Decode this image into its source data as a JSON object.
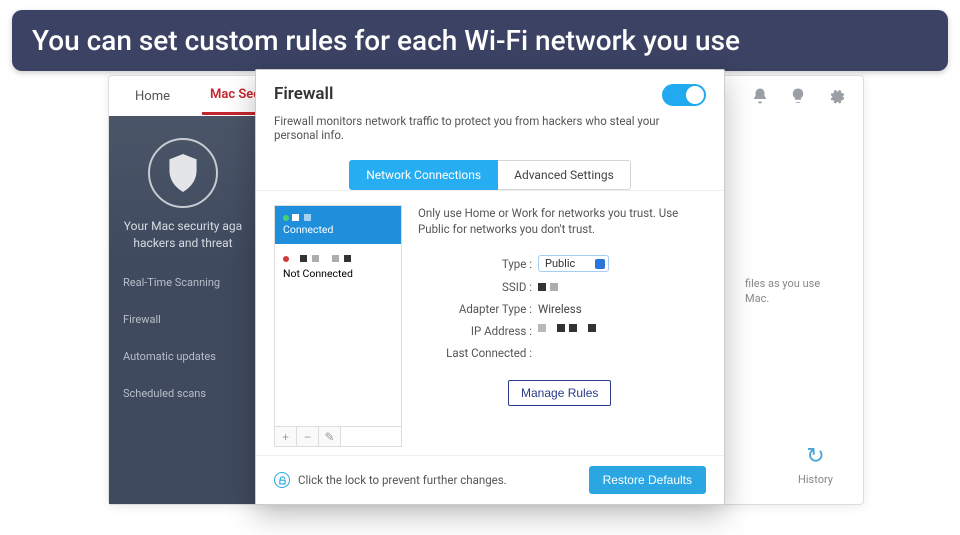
{
  "caption": "You can set custom rules for each Wi-Fi network you use",
  "topnav": {
    "tabs": [
      "Home",
      "Mac Security"
    ],
    "active_index": 1,
    "icons": [
      "bell-icon",
      "bulb-icon",
      "gear-icon"
    ]
  },
  "sidebar": {
    "hero_line1": "Your Mac security aga",
    "hero_line2": "hackers and threat",
    "items": [
      "Real-Time Scanning",
      "Firewall",
      "Automatic updates",
      "Scheduled scans"
    ]
  },
  "bg_text": {
    "line1": "files as you use",
    "line2": "Mac."
  },
  "history_label": "History",
  "modal": {
    "title": "Firewall",
    "toggle_on": true,
    "description": "Firewall monitors network traffic to protect you from hackers who steal your personal info.",
    "subtabs": [
      "Network Connections",
      "Advanced Settings"
    ],
    "subtab_active": 0,
    "connections": [
      {
        "status": "Connected",
        "connected": true
      },
      {
        "status": "Not Connected",
        "connected": false
      }
    ],
    "list_buttons": [
      "+",
      "−",
      "✎"
    ],
    "hint": "Only use Home or Work for networks you trust. Use Public for networks you don't trust.",
    "fields": {
      "type_label": "Type :",
      "type_value": "Public",
      "ssid_label": "SSID :",
      "adapter_label": "Adapter Type :",
      "adapter_value": "Wireless",
      "ip_label": "IP Address :",
      "lastconn_label": "Last Connected :",
      "lastconn_value": ""
    },
    "manage_rules": "Manage Rules",
    "footer": {
      "lock_text": "Click the lock to prevent further changes.",
      "restore": "Restore Defaults"
    }
  }
}
